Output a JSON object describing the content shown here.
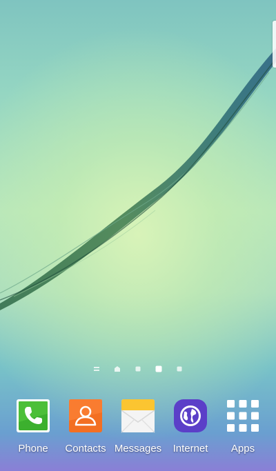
{
  "colors": {
    "phone_green": "#3cb02e",
    "contacts_orange": "#f36f22",
    "messages_yellow": "#fbc531",
    "internet_purple": "#5b3fc8"
  },
  "page_indicator": {
    "current_page": 4,
    "total_pages": 5
  },
  "dock": {
    "apps": [
      {
        "label": "Phone",
        "icon": "phone-icon"
      },
      {
        "label": "Contacts",
        "icon": "contacts-icon"
      },
      {
        "label": "Messages",
        "icon": "messages-icon"
      },
      {
        "label": "Internet",
        "icon": "internet-icon"
      },
      {
        "label": "Apps",
        "icon": "apps-grid-icon"
      }
    ]
  }
}
